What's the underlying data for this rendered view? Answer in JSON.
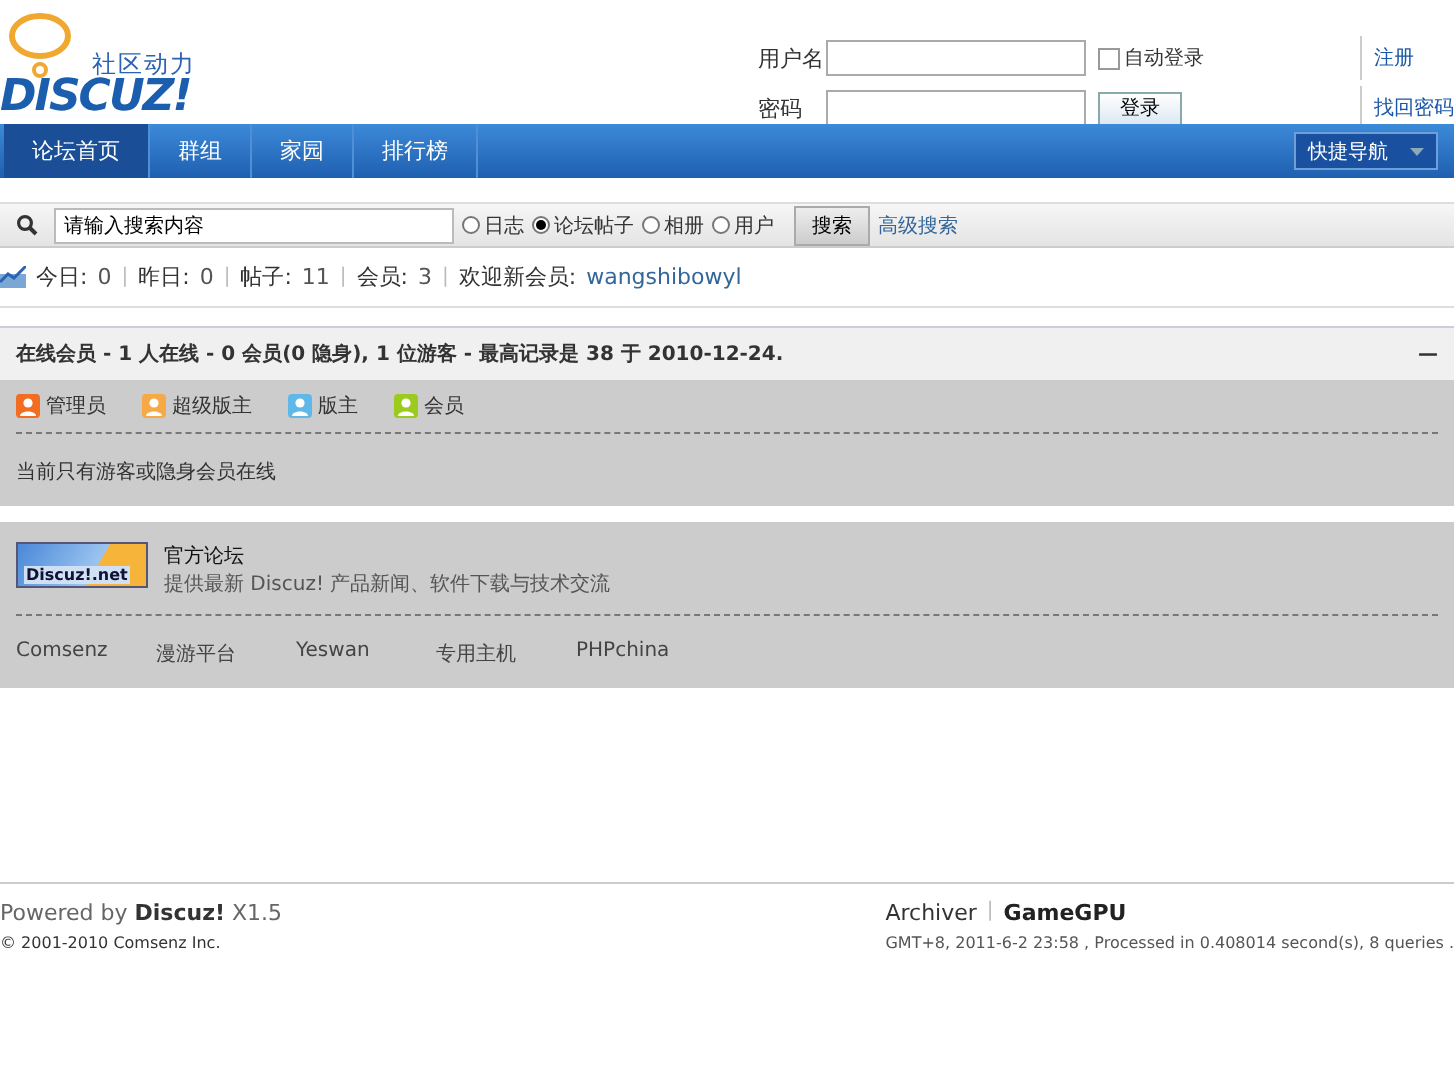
{
  "header": {
    "logo": {
      "tagline": "社区动力",
      "wordmark": "DISCUZ!"
    },
    "login": {
      "username_label": "用户名",
      "password_label": "密码",
      "remember": {
        "label": "自动登录",
        "checked": false
      },
      "submit": "登录",
      "links": [
        "注册",
        "找回密码"
      ]
    }
  },
  "nav": {
    "items": [
      {
        "label": "论坛首页",
        "selected": true
      },
      {
        "label": "群组",
        "selected": false
      },
      {
        "label": "家园",
        "selected": false
      },
      {
        "label": "排行榜",
        "selected": false
      }
    ],
    "quick_menu": "快捷导航"
  },
  "search": {
    "value": "请输入搜索内容",
    "options": [
      {
        "label": "日志",
        "selected": false
      },
      {
        "label": "论坛帖子",
        "selected": true
      },
      {
        "label": "相册",
        "selected": false
      },
      {
        "label": "用户",
        "selected": false
      }
    ],
    "button": "搜索",
    "advanced": "高级搜索"
  },
  "stats": [
    {
      "label": "今日:",
      "value": "0",
      "separator": "|"
    },
    {
      "label": "昨日:",
      "value": "0",
      "separator": "|"
    },
    {
      "label": "帖子:",
      "value": "11",
      "separator": "|"
    },
    {
      "label": "会员:",
      "value": "3",
      "separator": "|"
    }
  ],
  "newest_member": {
    "label": "欢迎新会员:",
    "name": "wangshibowyl"
  },
  "online": {
    "heading": "在线会员 - 1 人在线 - 0 会员(0 隐身), 1 位游客 - 最高记录是 38 于 2010-12-24.",
    "collapse": "—",
    "legend": [
      {
        "label": "管理员",
        "color": "#f26c22"
      },
      {
        "label": "超级版主",
        "color": "#f7a945"
      },
      {
        "label": "版主",
        "color": "#5fb8e8"
      },
      {
        "label": "会员",
        "color": "#9bcb1f"
      }
    ],
    "message": "当前只有游客或隐身会员在线"
  },
  "links": {
    "featured": {
      "badge": "Discuz!.net",
      "title": "官方论坛",
      "description": "提供最新 Discuz! 产品新闻、软件下载与技术交流"
    },
    "text_links": [
      "Comsenz",
      "漫游平台",
      "Yeswan",
      "专用主机",
      "PHPchina"
    ]
  },
  "footer": {
    "powered_prefix": "Powered by",
    "product": "Discuz!",
    "version": "X1.5",
    "copyright": "© 2001-2010 Comsenz Inc.",
    "links": [
      "Archiver",
      "GameGPU"
    ],
    "separator": "|",
    "debug": "GMT+8, 2011-6-2 23:58 , Processed in 0.408014 second(s), 8 queries ."
  }
}
